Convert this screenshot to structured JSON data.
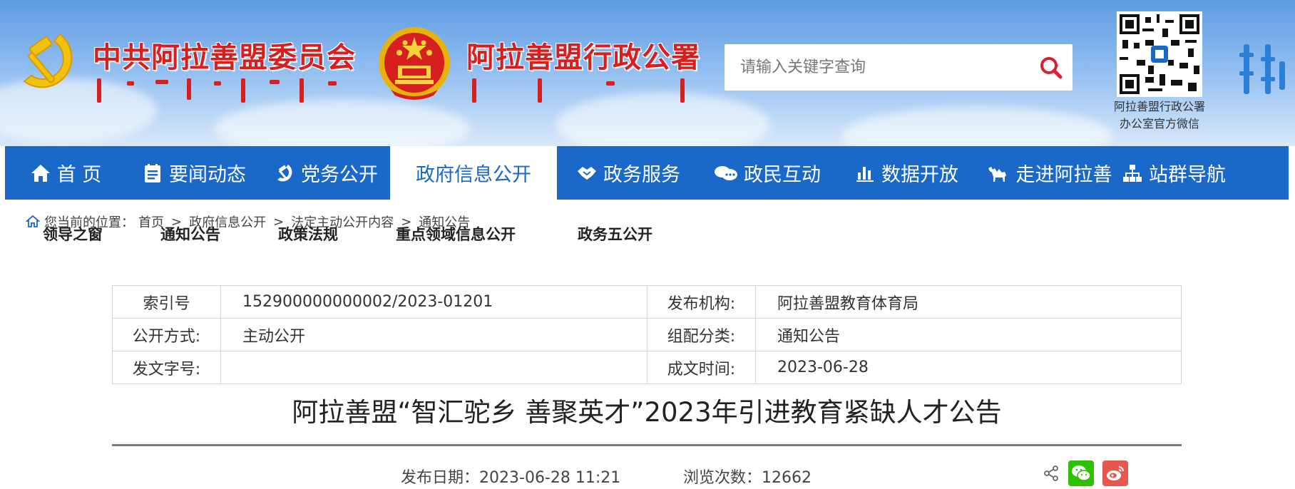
{
  "header": {
    "party_title": "中共阿拉善盟委员会",
    "gov_title": "阿拉善盟行政公署",
    "search": {
      "placeholder": "请输入关键字查询"
    },
    "qr_caption_line1": "阿拉善盟行政公署",
    "qr_caption_line2": "办公室官方微信"
  },
  "nav": {
    "items": [
      {
        "label": "首 页",
        "icon": "home-icon"
      },
      {
        "label": "要闻动态",
        "icon": "news-icon"
      },
      {
        "label": "党务公开",
        "icon": "party-icon"
      },
      {
        "label": "政府信息公开",
        "icon": "",
        "active": true
      },
      {
        "label": "政务服务",
        "icon": "handshake-icon"
      },
      {
        "label": "政民互动",
        "icon": "chat-icon"
      },
      {
        "label": "数据开放",
        "icon": "bar-chart-icon"
      },
      {
        "label": "走进阿拉善",
        "icon": "camel-icon"
      },
      {
        "label": "站群导航",
        "icon": "sitemap-icon"
      }
    ]
  },
  "breadcrumb": {
    "prefix": "您当前的位置：",
    "items": [
      "首页",
      "政府信息公开",
      "法定主动公开内容",
      "通知公告"
    ],
    "separator": ">"
  },
  "subnav": {
    "items": [
      "领导之窗",
      "通知公告",
      "政策法规",
      "重点领域信息公开",
      "政务五公开"
    ]
  },
  "meta": {
    "index_label": "索引号",
    "index_value": "152900000000002/2023-01201",
    "org_label": "发布机构:",
    "org_value": "阿拉善盟教育体育局",
    "method_label": "公开方式:",
    "method_value": "主动公开",
    "category_label": "组配分类:",
    "category_value": "通知公告",
    "docno_label": "发文字号:",
    "docno_value": "",
    "date_label": "成文时间:",
    "date_value": "2023-06-28"
  },
  "article": {
    "title": "阿拉善盟“智汇驼乡 善聚英才”2023年引进教育紧缺人才公告",
    "publish_label": "发布日期：",
    "publish_value": "2023-06-28 11:21",
    "views_label": "浏览次数：",
    "views_value": "12662"
  },
  "colors": {
    "nav_bg": "#1a68c8",
    "title_red": "#d61f1f",
    "wechat_green": "#2dc100",
    "weibo_red": "#e6584e"
  }
}
